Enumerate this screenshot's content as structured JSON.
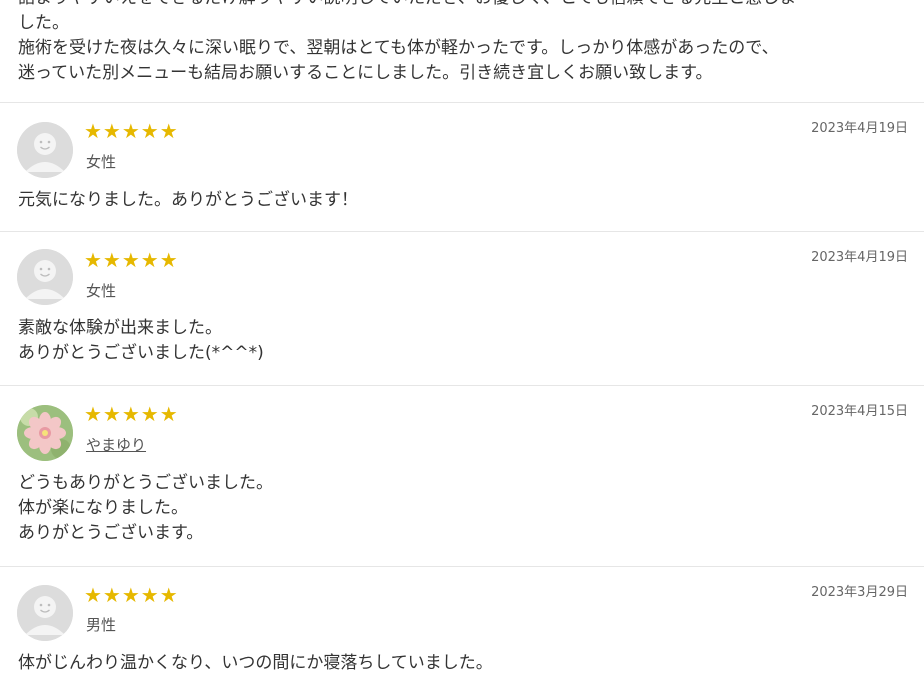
{
  "top_review": {
    "lines": [
      "詰まりやすいえをできるだけ解りやすい説明していただき、お優しく、とても信頼できる先生と感じま",
      "した。",
      "施術を受けた夜は久々に深い眠りで、翌朝はとても体が軽かったです。しっかり体感があったので、",
      "迷っていた別メニューも結局お願いすることにしました。引き続き宜しくお願い致します。"
    ]
  },
  "reviews": [
    {
      "stars": "★★★★★",
      "rating": 5,
      "author": "女性",
      "date": "2023年4月19日",
      "lines": [
        "元気になりました。ありがとうございます！"
      ],
      "avatar_icon": "default-user-icon"
    },
    {
      "stars": "★★★★★",
      "rating": 5,
      "author": "女性",
      "date": "2023年4月19日",
      "lines": [
        "素敵な体験が出来ました。",
        "ありがとうございました(*^^*)"
      ],
      "avatar_icon": "default-user-icon"
    },
    {
      "stars": "★★★★★",
      "rating": 5,
      "author": "やまゆり",
      "date": "2023年4月15日",
      "lines": [
        "どうもありがとうございました。",
        "体が楽になりました。",
        "ありがとうございます。"
      ],
      "avatar_icon": "flower-photo-avatar"
    },
    {
      "stars": "★★★★★",
      "rating": 5,
      "author": "男性",
      "date": "2023年3月29日",
      "lines": [
        "体がじんわり温かくなり、いつの間にか寝落ちしていました。"
      ],
      "avatar_icon": "default-user-icon"
    }
  ],
  "colors": {
    "star": "#e6b800",
    "divider": "#e6e6e6",
    "avatar_bg": "#dcdcdc"
  }
}
